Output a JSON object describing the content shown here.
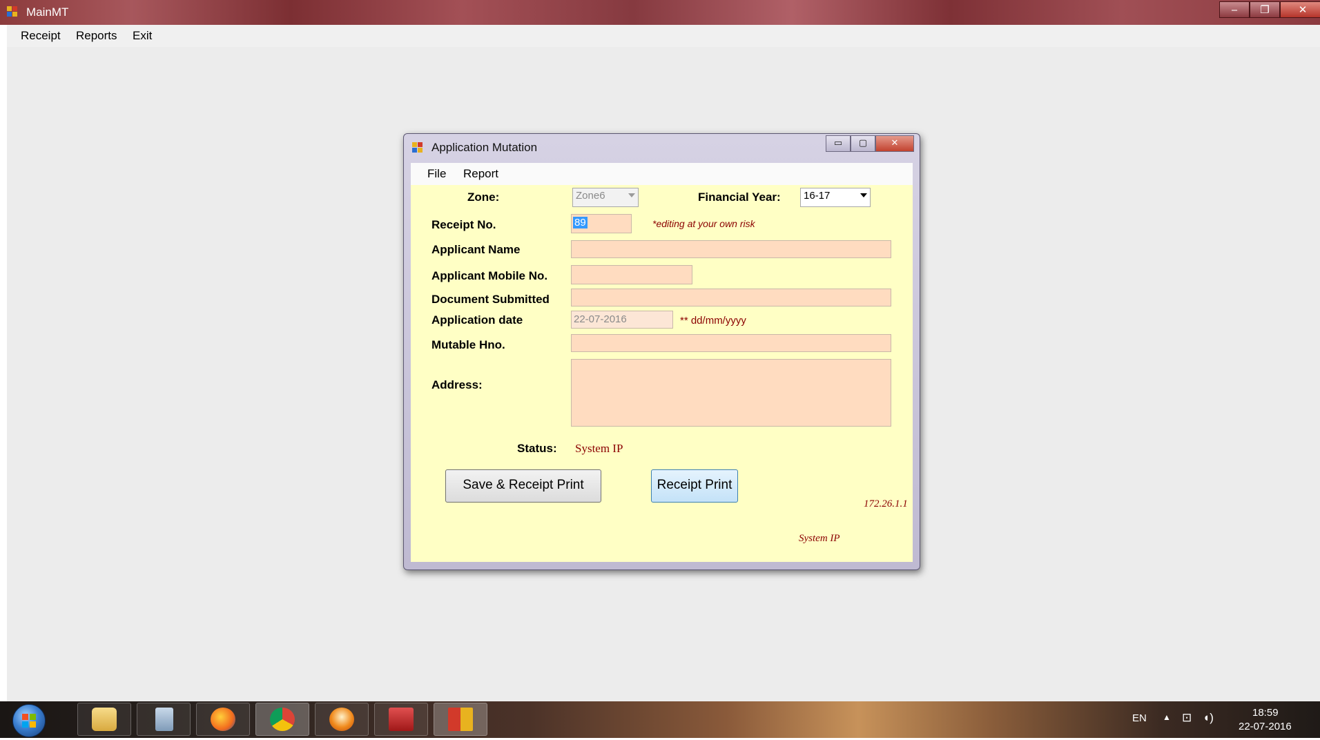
{
  "main_window": {
    "title": "MainMT",
    "controls": {
      "minimize": "‒",
      "restore": "❐",
      "close": "✕"
    },
    "menu": [
      "Receipt",
      "Reports",
      "Exit"
    ]
  },
  "dialog": {
    "title": "Application Mutation",
    "controls": {
      "minimize": "▭",
      "restore": "▢",
      "close": "✕"
    },
    "menu": [
      "File",
      "Report"
    ],
    "form": {
      "zone_label": "Zone:",
      "zone_value": "Zone6",
      "financial_year_label": "Financial Year:",
      "financial_year_value": "16-17",
      "receipt_no_label": "Receipt No.",
      "receipt_no_value": "89",
      "receipt_no_note": "*editing at your own risk",
      "applicant_name_label": "Applicant Name",
      "applicant_name_value": "",
      "mobile_label": "Applicant Mobile No.",
      "mobile_value": "",
      "document_label": "Document Submitted",
      "document_value": "",
      "app_date_label": "Application date",
      "app_date_value": "22-07-2016",
      "app_date_note": "** dd/mm/yyyy",
      "hno_label": "Mutable Hno.",
      "hno_value": "",
      "address_label": "Address:",
      "address_value": "",
      "status_label": "Status:",
      "status_value": "System IP",
      "save_button": "Save & Receipt Print",
      "receipt_print_button": "Receipt Print",
      "ip_value": "172.26.1.1",
      "system_ip_label": "System IP"
    }
  },
  "taskbar": {
    "language": "EN",
    "time": "18:59",
    "date": "22-07-2016",
    "apps": [
      "file-explorer",
      "calculator",
      "firefox",
      "chrome",
      "vlc-like",
      "pdf-reader",
      "mainmt-app"
    ]
  },
  "colors": {
    "form_bg": "#ffffc5",
    "field_bg": "#ffdcc0",
    "note_color": "#8b0000",
    "receipt_button_bg": "#cfe8fb"
  }
}
